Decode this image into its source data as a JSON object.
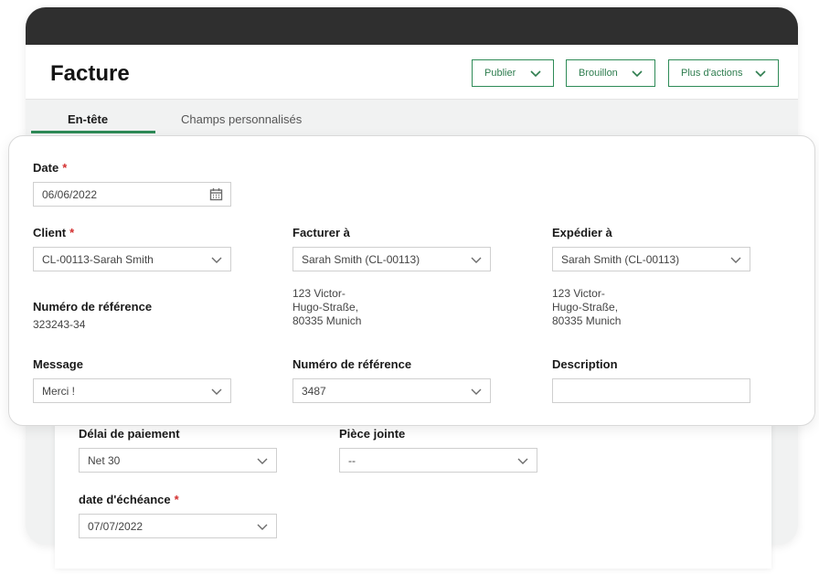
{
  "header": {
    "title": "Facture",
    "buttons": {
      "publish": "Publier",
      "draft": "Brouillon",
      "more": "Plus d'actions"
    }
  },
  "tabs": [
    {
      "label": "En-tête",
      "active": true
    },
    {
      "label": "Champs personnalisés",
      "active": false
    }
  ],
  "form": {
    "date": {
      "label": "Date",
      "value": "06/06/2022",
      "icon": "calendar-icon"
    },
    "client": {
      "label": "Client",
      "value": "CL-00113-Sarah Smith"
    },
    "bill_to": {
      "label": "Facturer à",
      "value": "Sarah Smith (CL-00113)",
      "address": [
        "123 Victor-",
        "Hugo-Straße,",
        "80335 Munich"
      ]
    },
    "ship_to": {
      "label": "Expédier à",
      "value": "Sarah Smith (CL-00113)",
      "address": [
        "123 Victor-",
        "Hugo-Straße,",
        "80335 Munich"
      ]
    },
    "reference_number": {
      "label": "Numéro de référence",
      "value": "323243-34"
    },
    "message": {
      "label": "Message",
      "value": "Merci !"
    },
    "reference_number_2": {
      "label": "Numéro de référence",
      "value": "3487"
    },
    "description": {
      "label": "Description",
      "value": ""
    },
    "required_marker": "*"
  },
  "background_form": {
    "payment_terms": {
      "label": "Délai de paiement",
      "value": "Net 30"
    },
    "attachment": {
      "label": "Pièce jointe",
      "value": "--"
    },
    "due_date": {
      "label": "date d'échéance",
      "value": "07/07/2022"
    }
  },
  "colors": {
    "accent": "#2e8b57",
    "required": "#d32f2f",
    "titlebar": "#2f2f2f"
  }
}
